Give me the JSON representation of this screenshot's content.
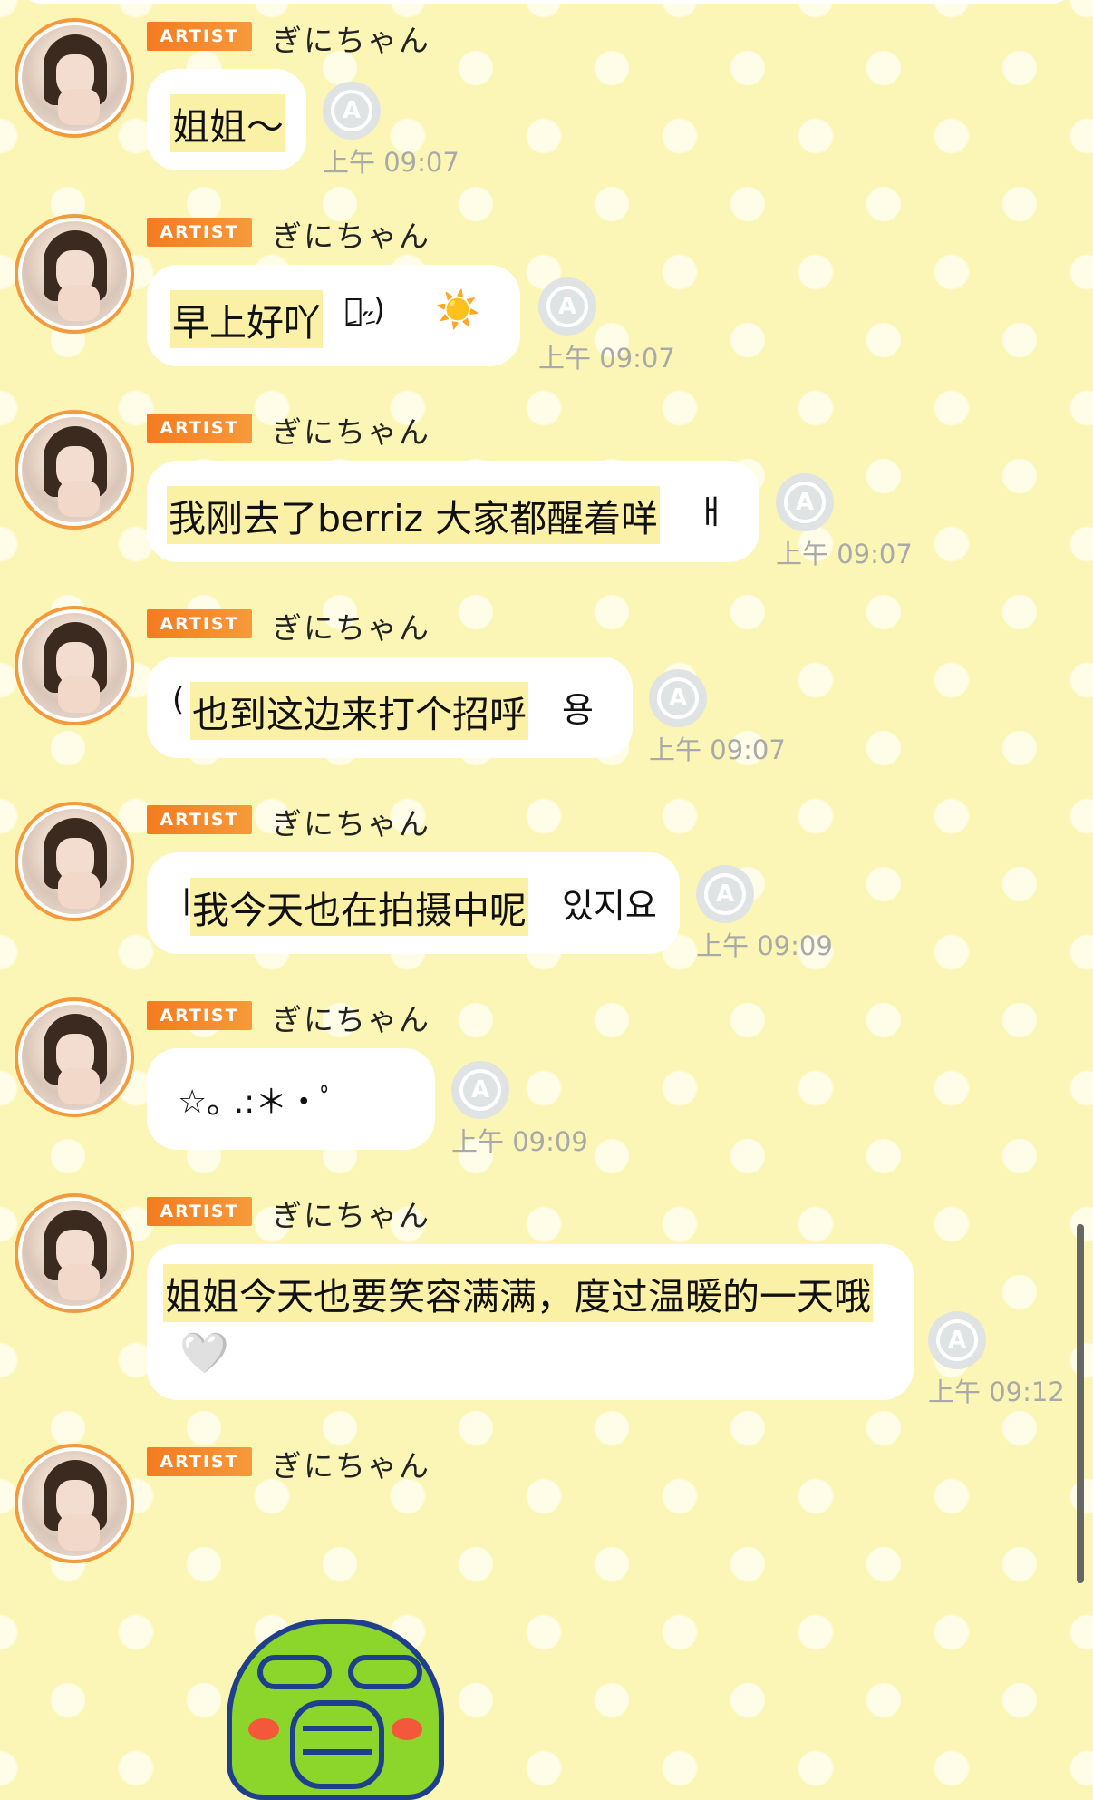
{
  "chat": {
    "sender_badge": "ARTIST",
    "sender_name": "ぎにちゃん",
    "messages": [
      {
        "text": "姐姐～",
        "time": "上午 09:07"
      },
      {
        "text": "早上好吖",
        "suffix": "ِ৺ِ˶)",
        "emoji": "☀️",
        "time": "上午 09:07"
      },
      {
        "text": "我刚去了berriz 大家都醒着咩",
        "tail": "ㅐ",
        "time": "上午 09:07"
      },
      {
        "prefix": "(",
        "text": "也到这边来打个招呼",
        "tail": "용",
        "time": "上午 09:07"
      },
      {
        "prefix": "ㅣ",
        "text": "我今天也在拍摄中呢",
        "tail": "있지요",
        "time": "上午 09:09"
      },
      {
        "text": "☆｡  .:＊・ﾟ",
        "time": "上午 09:09"
      },
      {
        "text": "姐姐今天也要笑容满满，度过温暖的一天哦",
        "emoji": "🤍",
        "time": "上午 09:12"
      }
    ],
    "last_message": {
      "type": "sticker",
      "sticker": "green-bird-sticker"
    }
  },
  "icons": {
    "reaction": "A",
    "reaction_icon": "translate-a-icon"
  },
  "colors": {
    "badge": "#f47b20",
    "avatar_ring": "#f39a3c",
    "highlight": "#fbf1a6",
    "background": "#fbf6b5"
  }
}
